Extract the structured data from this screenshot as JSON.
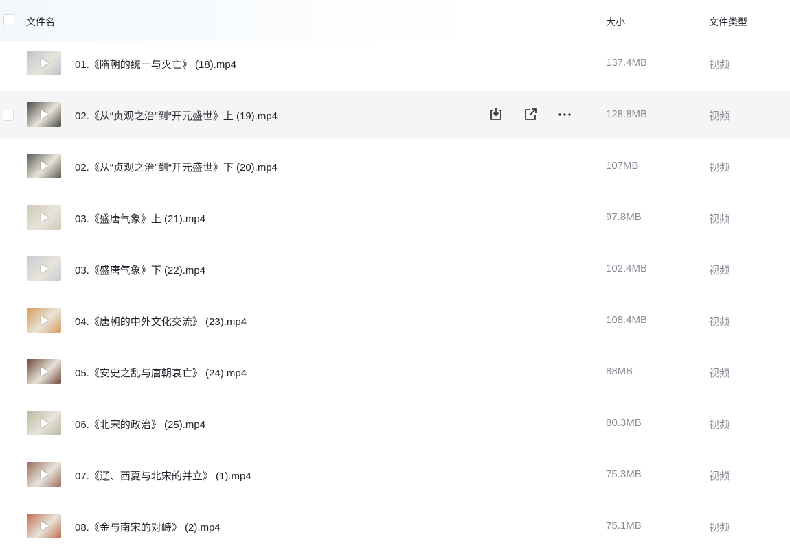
{
  "header": {
    "name_col": "文件名",
    "size_col": "大小",
    "type_col": "文件类型"
  },
  "files": [
    {
      "name": "01.《隋朝的统一与灭亡》 (18).mp4",
      "size": "137.4MB",
      "type": "视频",
      "thumb_color": "#b9c3cc"
    },
    {
      "name": "02.《从“贞观之治”到“开元盛世》上 (19).mp4",
      "size": "128.8MB",
      "type": "视频",
      "thumb_color": "#4a4a44"
    },
    {
      "name": "02.《从“贞观之治”到“开元盛世》下 (20).mp4",
      "size": "107MB",
      "type": "视频",
      "thumb_color": "#5a5a50"
    },
    {
      "name": "03.《盛唐气象》上 (21).mp4",
      "size": "97.8MB",
      "type": "视频",
      "thumb_color": "#cfc9b6"
    },
    {
      "name": "03.《盛唐气象》下 (22).mp4",
      "size": "102.4MB",
      "type": "视频",
      "thumb_color": "#c5cad2"
    },
    {
      "name": "04.《唐朝的中外文化交流》 (23).mp4",
      "size": "108.4MB",
      "type": "视频",
      "thumb_color": "#d99a56"
    },
    {
      "name": "05.《安史之乱与唐朝衰亡》 (24).mp4",
      "size": "88MB",
      "type": "视频",
      "thumb_color": "#6e4638"
    },
    {
      "name": "06.《北宋的政治》 (25).mp4",
      "size": "80.3MB",
      "type": "视频",
      "thumb_color": "#b7b79e"
    },
    {
      "name": "07.《辽、西夏与北宋的并立》 (1).mp4",
      "size": "75.3MB",
      "type": "视频",
      "thumb_color": "#9a6c5c"
    },
    {
      "name": "08.《金与南宋的对峙》 (2).mp4",
      "size": "75.1MB",
      "type": "视频",
      "thumb_color": "#c06a4c"
    }
  ],
  "hover_row_index": 1,
  "actions": [
    "download-icon",
    "share-icon",
    "more-icon"
  ],
  "colors": {
    "hover_bg": "#f5f5f5",
    "muted_text": "#878c94"
  }
}
